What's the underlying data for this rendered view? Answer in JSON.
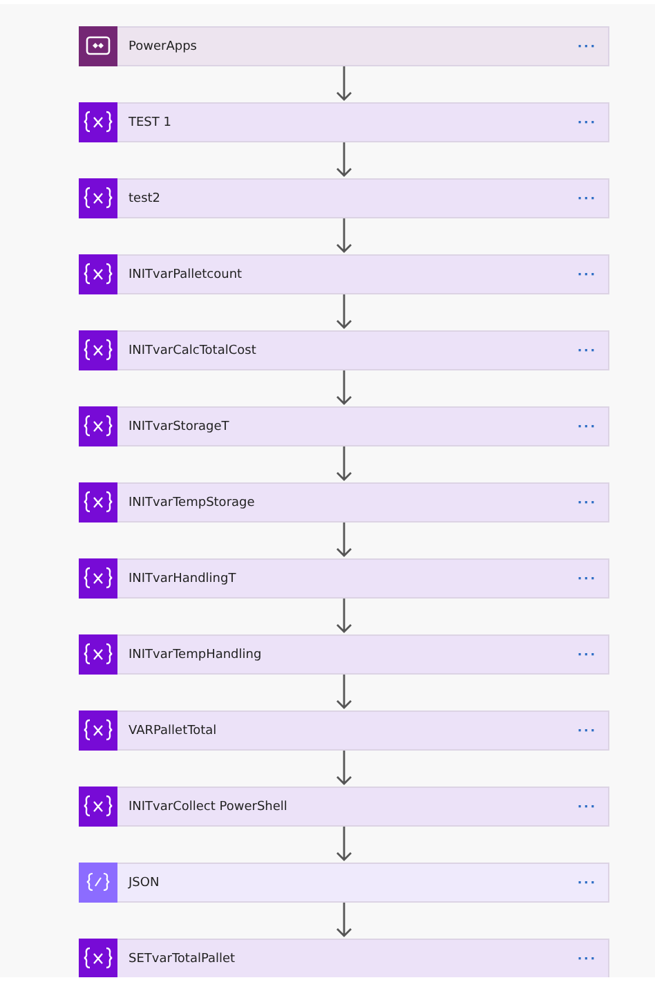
{
  "steps": [
    {
      "kind": "powerapps",
      "title": "PowerApps",
      "menu": "···"
    },
    {
      "kind": "variable",
      "title": "TEST 1",
      "menu": "···"
    },
    {
      "kind": "variable",
      "title": "test2",
      "menu": "···"
    },
    {
      "kind": "variable",
      "title": "INITvarPalletcount",
      "menu": "···"
    },
    {
      "kind": "variable",
      "title": "INITvarCalcTotalCost",
      "menu": "···"
    },
    {
      "kind": "variable",
      "title": "INITvarStorageT",
      "menu": "···"
    },
    {
      "kind": "variable",
      "title": "INITvarTempStorage",
      "menu": "···"
    },
    {
      "kind": "variable",
      "title": "INITvarHandlingT",
      "menu": "···"
    },
    {
      "kind": "variable",
      "title": "INITvarTempHandling",
      "menu": "···"
    },
    {
      "kind": "variable",
      "title": "VARPalletTotal",
      "menu": "···"
    },
    {
      "kind": "variable",
      "title": "INITvarCollect PowerShell",
      "menu": "···"
    },
    {
      "kind": "json",
      "title": "JSON",
      "menu": "···"
    },
    {
      "kind": "variable",
      "title": "SETvarTotalPallet",
      "menu": "···"
    }
  ]
}
